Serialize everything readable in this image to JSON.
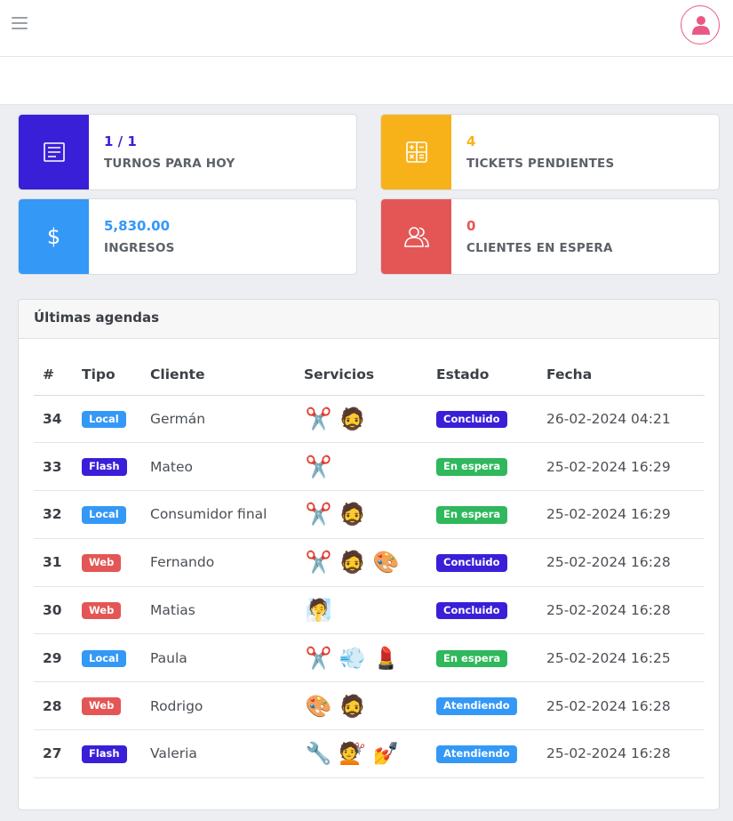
{
  "header": {
    "menu_icon": "hamburger-icon",
    "user_icon": "user-icon"
  },
  "cards": [
    {
      "value": "1 / 1",
      "label": "TURNOS PARA HOY",
      "icon": "list-icon",
      "color": "#3a1fd8"
    },
    {
      "value": "4",
      "label": "TICKETS PENDIENTES",
      "icon": "calculator-icon",
      "color": "#f8b219"
    },
    {
      "value": "5,830.00",
      "label": "INGRESOS",
      "icon": "dollar-icon",
      "color": "#3498f7"
    },
    {
      "value": "0",
      "label": "CLIENTES EN ESPERA",
      "icon": "users-icon",
      "color": "#e45656"
    }
  ],
  "agendas": {
    "title": "Últimas agendas",
    "columns": [
      "#",
      "Tipo",
      "Cliente",
      "Servicios",
      "Estado",
      "Fecha"
    ],
    "rows": [
      {
        "id": "34",
        "tipo": "Local",
        "cliente": "Germán",
        "servicios": [
          "haircut-icon",
          "beard-icon"
        ],
        "estado": "Concluido",
        "fecha": "26-02-2024 04:21"
      },
      {
        "id": "33",
        "tipo": "Flash",
        "cliente": "Mateo",
        "servicios": [
          "haircut-icon"
        ],
        "estado": "En espera",
        "fecha": "25-02-2024 16:29"
      },
      {
        "id": "32",
        "tipo": "Local",
        "cliente": "Consumidor final",
        "servicios": [
          "haircut-icon",
          "beard-icon"
        ],
        "estado": "En espera",
        "fecha": "25-02-2024 16:29"
      },
      {
        "id": "31",
        "tipo": "Web",
        "cliente": "Fernando",
        "servicios": [
          "haircut-icon",
          "beard-icon",
          "hair-dye-icon"
        ],
        "estado": "Concluido",
        "fecha": "25-02-2024 16:28"
      },
      {
        "id": "30",
        "tipo": "Web",
        "cliente": "Matias",
        "servicios": [
          "face-treatment-icon"
        ],
        "estado": "Concluido",
        "fecha": "25-02-2024 16:28"
      },
      {
        "id": "29",
        "tipo": "Local",
        "cliente": "Paula",
        "servicios": [
          "scissors-icon",
          "hairdryer-icon",
          "makeup-icon"
        ],
        "estado": "En espera",
        "fecha": "25-02-2024 16:25"
      },
      {
        "id": "28",
        "tipo": "Web",
        "cliente": "Rodrigo",
        "servicios": [
          "hair-dye-icon",
          "beard-icon"
        ],
        "estado": "Atendiendo",
        "fecha": "25-02-2024 16:28"
      },
      {
        "id": "27",
        "tipo": "Flash",
        "cliente": "Valeria",
        "servicios": [
          "hair-straightener-icon",
          "wig-icon",
          "nails-icon"
        ],
        "estado": "Atendiendo",
        "fecha": "25-02-2024 16:28"
      }
    ]
  },
  "colors": {
    "tipo": {
      "Local": "#3498f7",
      "Flash": "#3a1fd8",
      "Web": "#e45656"
    },
    "estado": {
      "Concluido": "#3a1fd8",
      "En espera": "#2fb85c",
      "Atendiendo": "#3498f7"
    }
  }
}
